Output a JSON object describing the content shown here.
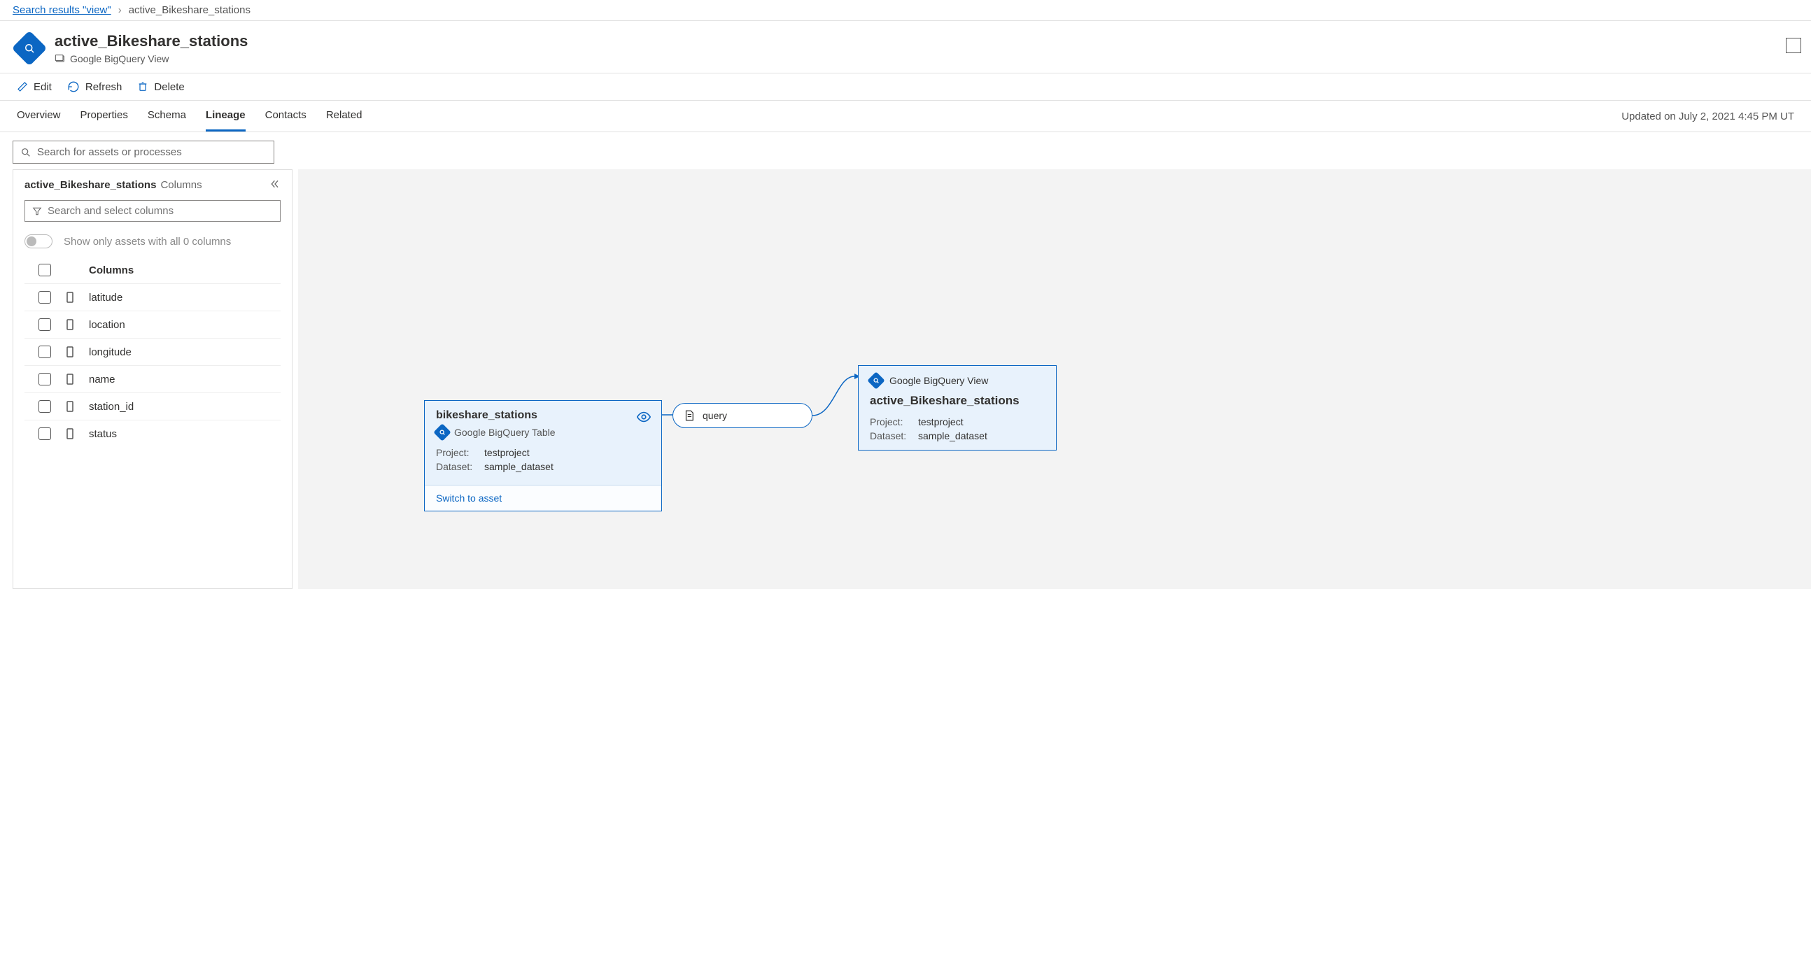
{
  "breadcrumb": {
    "back_label": "Search results \"view\"",
    "current": "active_Bikeshare_stations"
  },
  "header": {
    "title": "active_Bikeshare_stations",
    "subtitle": "Google BigQuery View"
  },
  "toolbar": {
    "edit": "Edit",
    "refresh": "Refresh",
    "delete": "Delete"
  },
  "tabs": {
    "items": [
      "Overview",
      "Properties",
      "Schema",
      "Lineage",
      "Contacts",
      "Related"
    ],
    "active": "Lineage",
    "updated": "Updated on July 2, 2021 4:45 PM UT"
  },
  "search": {
    "placeholder": "Search for assets or processes",
    "col_placeholder": "Search and select columns"
  },
  "sidebar": {
    "asset_name": "active_Bikeshare_stations",
    "columns_label": "Columns",
    "toggle_label": "Show only assets with all 0 columns",
    "header": "Columns",
    "columns": [
      "latitude",
      "location",
      "longitude",
      "name",
      "station_id",
      "status"
    ]
  },
  "lineage": {
    "node1": {
      "title": "bikeshare_stations",
      "type": "Google BigQuery Table",
      "project_k": "Project:",
      "project_v": "testproject",
      "dataset_k": "Dataset:",
      "dataset_v": "sample_dataset",
      "switch": "Switch to asset"
    },
    "process": {
      "label": "query"
    },
    "node2": {
      "type": "Google BigQuery View",
      "title": "active_Bikeshare_stations",
      "project_k": "Project:",
      "project_v": "testproject",
      "dataset_k": "Dataset:",
      "dataset_v": "sample_dataset"
    }
  }
}
